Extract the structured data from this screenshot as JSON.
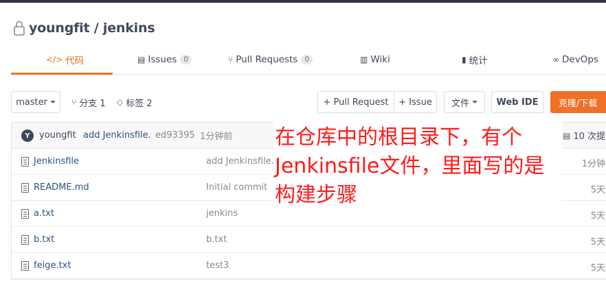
{
  "repo": {
    "title": "youngfit / jenkins"
  },
  "tabs": [
    {
      "label": "代码",
      "icon": "code-icon"
    },
    {
      "label": "Issues",
      "count": "0",
      "icon": "issues-icon"
    },
    {
      "label": "Pull Requests",
      "count": "0",
      "icon": "pull-request-icon"
    },
    {
      "label": "Wiki",
      "icon": "wiki-icon"
    },
    {
      "label": "统计",
      "icon": "stats-icon"
    },
    {
      "label": "DevOps",
      "icon": "devops-icon"
    }
  ],
  "toolbar": {
    "branch": "master",
    "branches": "分支 1",
    "tags": "标签 2",
    "pull_request": "+ Pull Request",
    "issue": "+ Issue",
    "file_menu": "文件",
    "web_ide": "Web IDE",
    "clone": "克隆/下载"
  },
  "commit": {
    "avatar": "Y",
    "author": "youngfit",
    "message": "add Jenkinsfile.",
    "sha": "ed93395",
    "time": "1分钟前",
    "commits": "10 次提"
  },
  "files": [
    {
      "name": "Jenkinsfile",
      "message": "add Jenkinsfile.",
      "time": "1分钟"
    },
    {
      "name": "README.md",
      "message": "Initial commit",
      "time": "5天"
    },
    {
      "name": "a.txt",
      "message": "jenkins",
      "time": "5天"
    },
    {
      "name": "b.txt",
      "message": "b.txt",
      "time": "5天"
    },
    {
      "name": "feige.txt",
      "message": "test3",
      "time": "5天"
    }
  ],
  "annotation": "在仓库中的根目录下，有个Jenkinsfile文件，里面写的是构建步骤",
  "colors": {
    "accent": "#f07026",
    "annotation": "#ff1a1a"
  }
}
